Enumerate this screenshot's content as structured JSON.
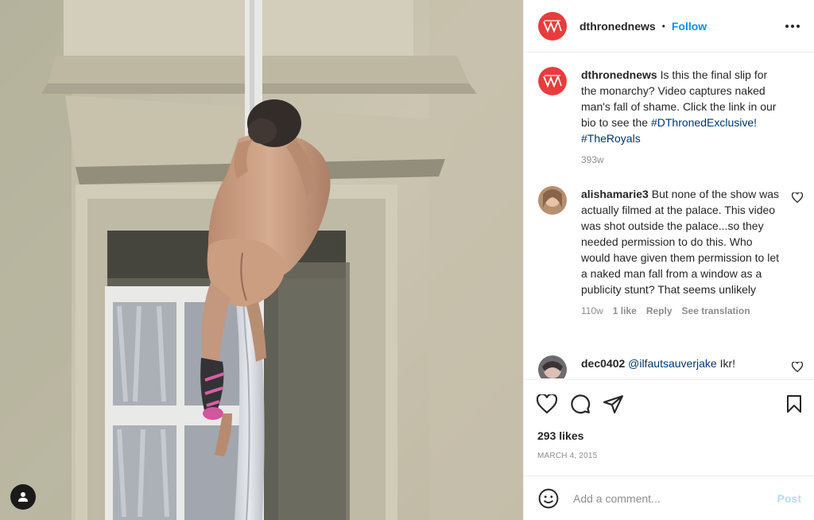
{
  "header": {
    "username": "dthronednews",
    "separator": "•",
    "follow_label": "Follow"
  },
  "caption": {
    "username": "dthronednews",
    "text": "Is this the final slip for the monarchy? Video captures naked man's fall of shame. Click the link in our bio to see the",
    "hashtags": "#DThronedExclusive! #TheRoyals",
    "time": "393w"
  },
  "comments": [
    {
      "username": "alishamarie3",
      "text": "But none of the show was actually filmed at the palace. This video was shot outside the palace...so they needed permission to do this. Who would have given them permission to let a naked man fall from a window as a publicity stunt? That seems unlikely",
      "time": "110w",
      "likes": "1 like",
      "reply": "Reply",
      "translate": "See translation"
    },
    {
      "username": "dec0402",
      "mention": "@ilfautsauverjake",
      "text": "Ikr!"
    }
  ],
  "post": {
    "likes": "293 likes",
    "date": "MARCH 4, 2015"
  },
  "add_comment": {
    "placeholder": "Add a comment...",
    "post_label": "Post"
  },
  "colors": {
    "brand_red": "#e93c3c",
    "link_blue": "#0095f6",
    "hashtag_blue": "#00376b",
    "muted": "#8e8e8e"
  },
  "icons": [
    "wordmark-logo-icon",
    "more-options-icon",
    "heart-icon",
    "comment-icon",
    "share-icon",
    "bookmark-icon",
    "emoji-icon",
    "user-tag-icon"
  ]
}
